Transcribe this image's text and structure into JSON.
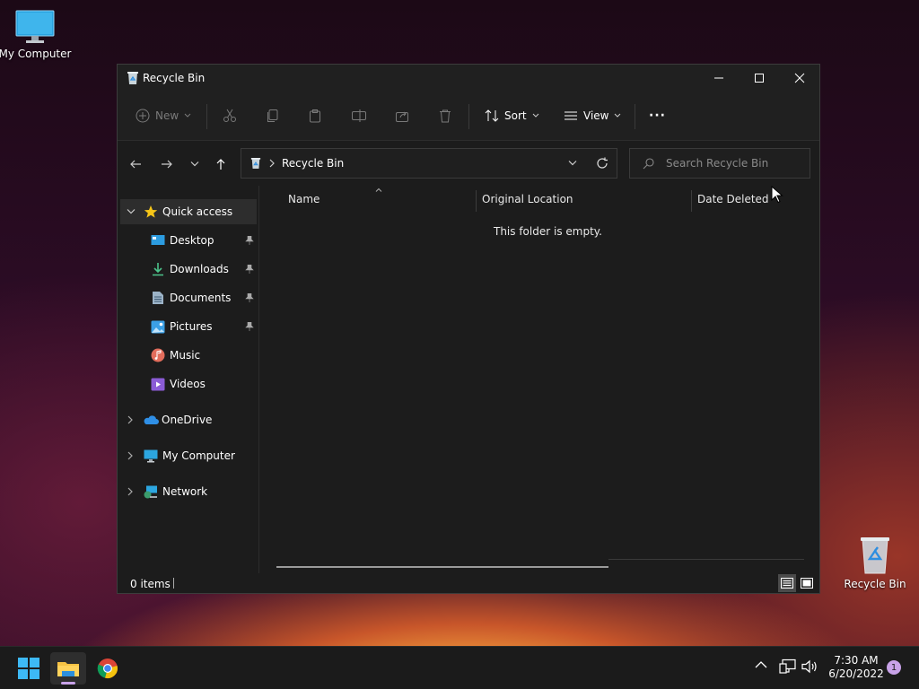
{
  "desktop": {
    "icons": [
      {
        "label": "My Computer",
        "icon": "monitor-icon"
      },
      {
        "label": "Recycle Bin",
        "icon": "recycle-bin-icon"
      }
    ]
  },
  "window": {
    "title": "Recycle Bin",
    "toolbar": {
      "new_label": "New",
      "sort_label": "Sort",
      "view_label": "View",
      "more_label": "···"
    },
    "nav": {
      "breadcrumb": "Recycle Bin",
      "search_placeholder": "Search Recycle Bin"
    },
    "sidebar": {
      "quick_access": "Quick access",
      "items": [
        {
          "label": "Desktop",
          "icon": "desktop-icon",
          "pinned": true
        },
        {
          "label": "Downloads",
          "icon": "download-icon",
          "pinned": true
        },
        {
          "label": "Documents",
          "icon": "document-icon",
          "pinned": true
        },
        {
          "label": "Pictures",
          "icon": "pictures-icon",
          "pinned": true
        },
        {
          "label": "Music",
          "icon": "music-icon",
          "pinned": false
        },
        {
          "label": "Videos",
          "icon": "videos-icon",
          "pinned": false
        }
      ],
      "onedrive": "OneDrive",
      "my_computer": "My Computer",
      "network": "Network"
    },
    "columns": [
      "Name",
      "Original Location",
      "Date Deleted"
    ],
    "empty_message": "This folder is empty.",
    "status_text": "0 items"
  },
  "taskbar": {
    "time": "7:30 AM",
    "date": "6/20/2022",
    "notification_count": "1"
  },
  "colors": {
    "accent": "#60cdff",
    "window_bg": "#1c1c1c",
    "toolbar_bg": "#202020",
    "taskbar_bg": "#1b1b1b",
    "badge": "#c8a2e8"
  }
}
